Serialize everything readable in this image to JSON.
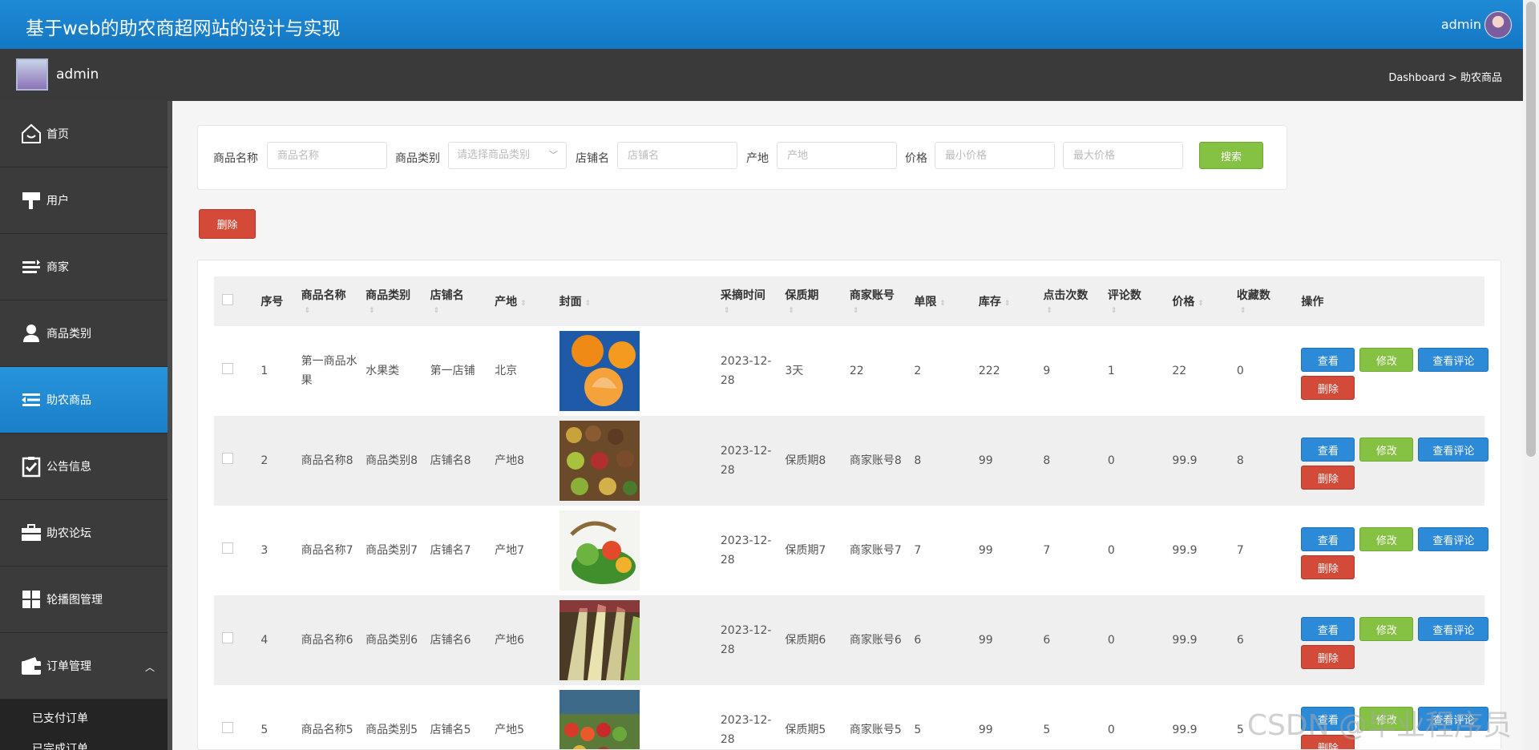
{
  "header": {
    "title": "基于web的助农商超网站的设计与实现",
    "user": "admin"
  },
  "subbar": {
    "name": "admin",
    "breadcrumb": "Dashboard > 助农商品"
  },
  "sidebar": {
    "items": [
      {
        "label": "首页",
        "icon": "home-icon"
      },
      {
        "label": "用户",
        "icon": "brush-icon"
      },
      {
        "label": "商家",
        "icon": "list-icon"
      },
      {
        "label": "商品类别",
        "icon": "person-icon"
      },
      {
        "label": "助农商品",
        "icon": "indent-icon"
      },
      {
        "label": "公告信息",
        "icon": "clipboard-check-icon"
      },
      {
        "label": "助农论坛",
        "icon": "briefcase-icon"
      },
      {
        "label": "轮播图管理",
        "icon": "grid-icon"
      },
      {
        "label": "订单管理",
        "icon": "wallet-icon"
      }
    ],
    "subitems": [
      {
        "label": "已支付订单"
      },
      {
        "label": "已完成订单"
      }
    ],
    "active_index": 4
  },
  "search": {
    "name_label": "商品名称",
    "name_placeholder": "商品名称",
    "category_label": "商品类别",
    "category_placeholder": "请选择商品类别",
    "shop_label": "店铺名",
    "shop_placeholder": "店铺名",
    "origin_label": "产地",
    "origin_placeholder": "产地",
    "price_label": "价格",
    "min_price_placeholder": "最小价格",
    "max_price_placeholder": "最大价格",
    "search_button": "搜索"
  },
  "delete_button": "删除",
  "table": {
    "headers": [
      "序号",
      "商品名称",
      "商品类别",
      "店铺名",
      "产地",
      "封面",
      "采摘时间",
      "保质期",
      "商家账号",
      "单限",
      "库存",
      "点击次数",
      "评论数",
      "价格",
      "收藏数",
      "操作"
    ],
    "rows": [
      {
        "no": "1",
        "name": "第一商品水果",
        "category": "水果类",
        "shop": "第一店铺",
        "origin": "北京",
        "cover": "oranges",
        "pick_time": "2023-12-28",
        "shelf_life": "3天",
        "merchant": "22",
        "limit": "2",
        "stock": "222",
        "clicks": "9",
        "comments": "1",
        "price": "22",
        "favorites": "0"
      },
      {
        "no": "2",
        "name": "商品名称8",
        "category": "商品类别8",
        "shop": "店铺名8",
        "origin": "产地8",
        "cover": "fruits-market",
        "pick_time": "2023-12-28",
        "shelf_life": "保质期8",
        "merchant": "商家账号8",
        "limit": "8",
        "stock": "99",
        "clicks": "8",
        "comments": "0",
        "price": "99.9",
        "favorites": "8"
      },
      {
        "no": "3",
        "name": "商品名称7",
        "category": "商品类别7",
        "shop": "店铺名7",
        "origin": "产地7",
        "cover": "vegetable-basket",
        "pick_time": "2023-12-28",
        "shelf_life": "保质期7",
        "merchant": "商家账号7",
        "limit": "7",
        "stock": "99",
        "clicks": "7",
        "comments": "0",
        "price": "99.9",
        "favorites": "7"
      },
      {
        "no": "4",
        "name": "商品名称6",
        "category": "商品类别6",
        "shop": "店铺名6",
        "origin": "产地6",
        "cover": "corn",
        "pick_time": "2023-12-28",
        "shelf_life": "保质期6",
        "merchant": "商家账号6",
        "limit": "6",
        "stock": "99",
        "clicks": "6",
        "comments": "0",
        "price": "99.9",
        "favorites": "6"
      },
      {
        "no": "5",
        "name": "商品名称5",
        "category": "商品类别5",
        "shop": "店铺名5",
        "origin": "产地5",
        "cover": "market-stall",
        "pick_time": "2023-12-28",
        "shelf_life": "保质期5",
        "merchant": "商家账号5",
        "limit": "5",
        "stock": "99",
        "clicks": "5",
        "comments": "0",
        "price": "99.9",
        "favorites": "5"
      }
    ],
    "actions": {
      "view": "查看",
      "edit": "修改",
      "view_comments": "查看评论",
      "delete": "删除"
    }
  },
  "watermark": "CSDN @毕业程序员",
  "colors": {
    "topbar": "#1f8ad6",
    "sidebar": "#3b3b3b",
    "active": "#2794dd",
    "green": "#85c143",
    "red": "#d34a38",
    "blue": "#2c8ad7"
  }
}
